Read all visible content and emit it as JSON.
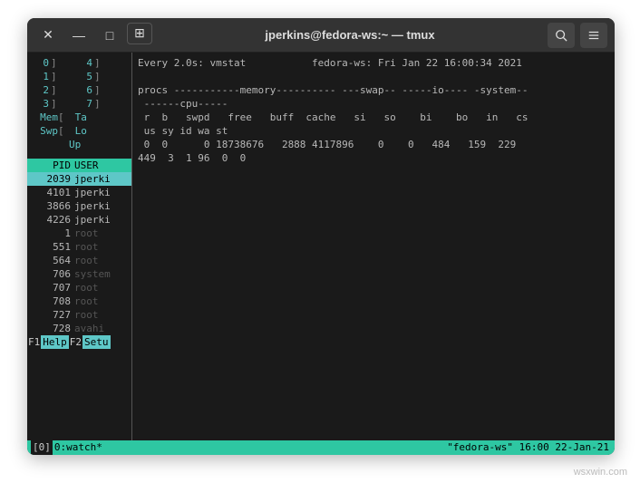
{
  "window": {
    "title": "jperkins@fedora-ws:~ — tmux"
  },
  "left_pane": {
    "cpus": [
      {
        "n": "0",
        "n2": "4"
      },
      {
        "n": "1",
        "n2": "5"
      },
      {
        "n": "2",
        "n2": "6"
      },
      {
        "n": "3",
        "n2": "7"
      }
    ],
    "mem_rows": [
      {
        "l": "Mem",
        "br": "[",
        "r": "Ta"
      },
      {
        "l": "Swp",
        "br": "[",
        "r": "Lo"
      },
      {
        "l": "",
        "br": "",
        "r": "Up"
      }
    ],
    "proc_header": {
      "pid": "PID",
      "user": "USER"
    },
    "processes": [
      {
        "pid": "2039",
        "user": "jperki",
        "sel": true,
        "dim": false
      },
      {
        "pid": "4101",
        "user": "jperki",
        "sel": false,
        "dim": false
      },
      {
        "pid": "3866",
        "user": "jperki",
        "sel": false,
        "dim": false
      },
      {
        "pid": "4226",
        "user": "jperki",
        "sel": false,
        "dim": false
      },
      {
        "pid": "1",
        "user": "root",
        "sel": false,
        "dim": true
      },
      {
        "pid": "551",
        "user": "root",
        "sel": false,
        "dim": true
      },
      {
        "pid": "564",
        "user": "root",
        "sel": false,
        "dim": true
      },
      {
        "pid": "706",
        "user": "system",
        "sel": false,
        "dim": true
      },
      {
        "pid": "707",
        "user": "root",
        "sel": false,
        "dim": true
      },
      {
        "pid": "708",
        "user": "root",
        "sel": false,
        "dim": true
      },
      {
        "pid": "727",
        "user": "root",
        "sel": false,
        "dim": true
      },
      {
        "pid": "728",
        "user": "avahi",
        "sel": false,
        "dim": true
      }
    ],
    "fkeys": [
      {
        "k": "F1",
        "l": "Help"
      },
      {
        "k": "F2",
        "l": "Setu"
      }
    ]
  },
  "right_pane": {
    "lines": [
      "Every 2.0s: vmstat           fedora-ws: Fri Jan 22 16:00:34 2021",
      "",
      "procs -----------memory---------- ---swap-- -----io---- -system--",
      " ------cpu-----",
      " r  b   swpd   free   buff  cache   si   so    bi    bo   in   cs",
      " us sy id wa st",
      " 0  0      0 18738676   2888 4117896    0    0   484   159  229 ",
      "449  3  1 96  0  0"
    ]
  },
  "statusbar": {
    "session": "[0]",
    "win": "0:watch*",
    "right": "\"fedora-ws\" 16:00 22-Jan-21"
  },
  "watermark": "wsxwin.com"
}
